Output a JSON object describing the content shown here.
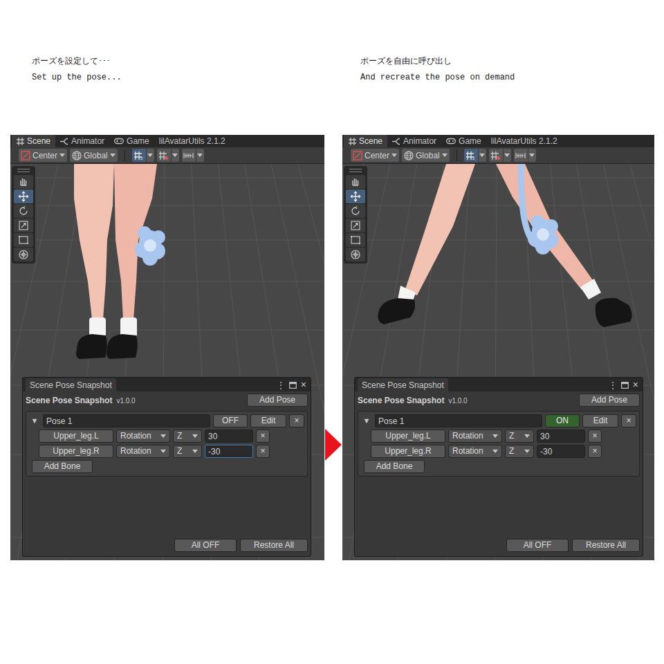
{
  "captions": [
    {
      "ja": "ポーズを設定して･･･",
      "en": "Set up the pose..."
    },
    {
      "ja": "ポーズを自由に呼び出し",
      "en": "And recreate the pose on demand"
    }
  ],
  "screens": [
    {
      "tabs": [
        {
          "label": "Scene",
          "selected": true
        },
        {
          "label": "Animator",
          "selected": false
        },
        {
          "label": "Game",
          "selected": false
        },
        {
          "label": "lilAvatarUtils 2.1.2",
          "selected": false
        }
      ],
      "toolbar": {
        "pivot": "Center",
        "space": "Global",
        "buttons": [
          {
            "selected": true
          },
          {
            "selected": false
          },
          {
            "selected": false
          }
        ]
      },
      "tools": [
        {
          "selected": false
        },
        {
          "selected": true
        },
        {
          "selected": false
        },
        {
          "selected": false
        },
        {
          "selected": false
        },
        {
          "selected": false
        }
      ],
      "scene": {
        "kind": "standing"
      },
      "window": {
        "tab": "Scene Pose Snapshot",
        "menu": "⋮",
        "close": "×",
        "title": "Scene Pose Snapshot",
        "version": "v1.0.0",
        "add_pose": "Add Pose",
        "poses": [
          {
            "expander": "▼",
            "expanded": true,
            "name": "Pose 1",
            "on": false,
            "toggle": "OFF",
            "edit": "Edit",
            "remove": "×",
            "bones": [
              {
                "bone": "Upper_leg.L",
                "property": "Rotation",
                "axis": "Z",
                "value": "30",
                "remove": "×",
                "focused": false
              },
              {
                "bone": "Upper_leg.R",
                "property": "Rotation",
                "axis": "Z",
                "value": "-30",
                "remove": "×",
                "focused": true
              }
            ],
            "add_bone": "Add Bone"
          }
        ],
        "all_off": "All OFF",
        "restore_all": "Restore All"
      }
    },
    {
      "tabs": [
        {
          "label": "Scene",
          "selected": true
        },
        {
          "label": "Animator",
          "selected": false
        },
        {
          "label": "Game",
          "selected": false
        },
        {
          "label": "lilAvatarUtils 2.1.2",
          "selected": false
        }
      ],
      "toolbar": {
        "pivot": "Center",
        "space": "Global",
        "buttons": [
          {
            "selected": true
          },
          {
            "selected": false
          },
          {
            "selected": false
          }
        ]
      },
      "tools": [
        {
          "selected": false
        },
        {
          "selected": true
        },
        {
          "selected": false
        },
        {
          "selected": false
        },
        {
          "selected": false
        },
        {
          "selected": false
        }
      ],
      "scene": {
        "kind": "spread"
      },
      "window": {
        "tab": "Scene Pose Snapshot",
        "menu": "⋮",
        "close": "×",
        "title": "Scene Pose Snapshot",
        "version": "v1.0.0",
        "add_pose": "Add Pose",
        "poses": [
          {
            "expander": "▼",
            "expanded": true,
            "name": "Pose 1",
            "on": true,
            "toggle": "ON",
            "edit": "Edit",
            "remove": "×",
            "bones": [
              {
                "bone": "Upper_leg.L",
                "property": "Rotation",
                "axis": "Z",
                "value": "30",
                "remove": "×",
                "focused": false
              },
              {
                "bone": "Upper_leg.R",
                "property": "Rotation",
                "axis": "Z",
                "value": "-30",
                "remove": "×",
                "focused": false
              }
            ],
            "add_bone": "Add Bone"
          }
        ],
        "all_off": "All OFF",
        "restore_all": "Restore All"
      }
    }
  ]
}
